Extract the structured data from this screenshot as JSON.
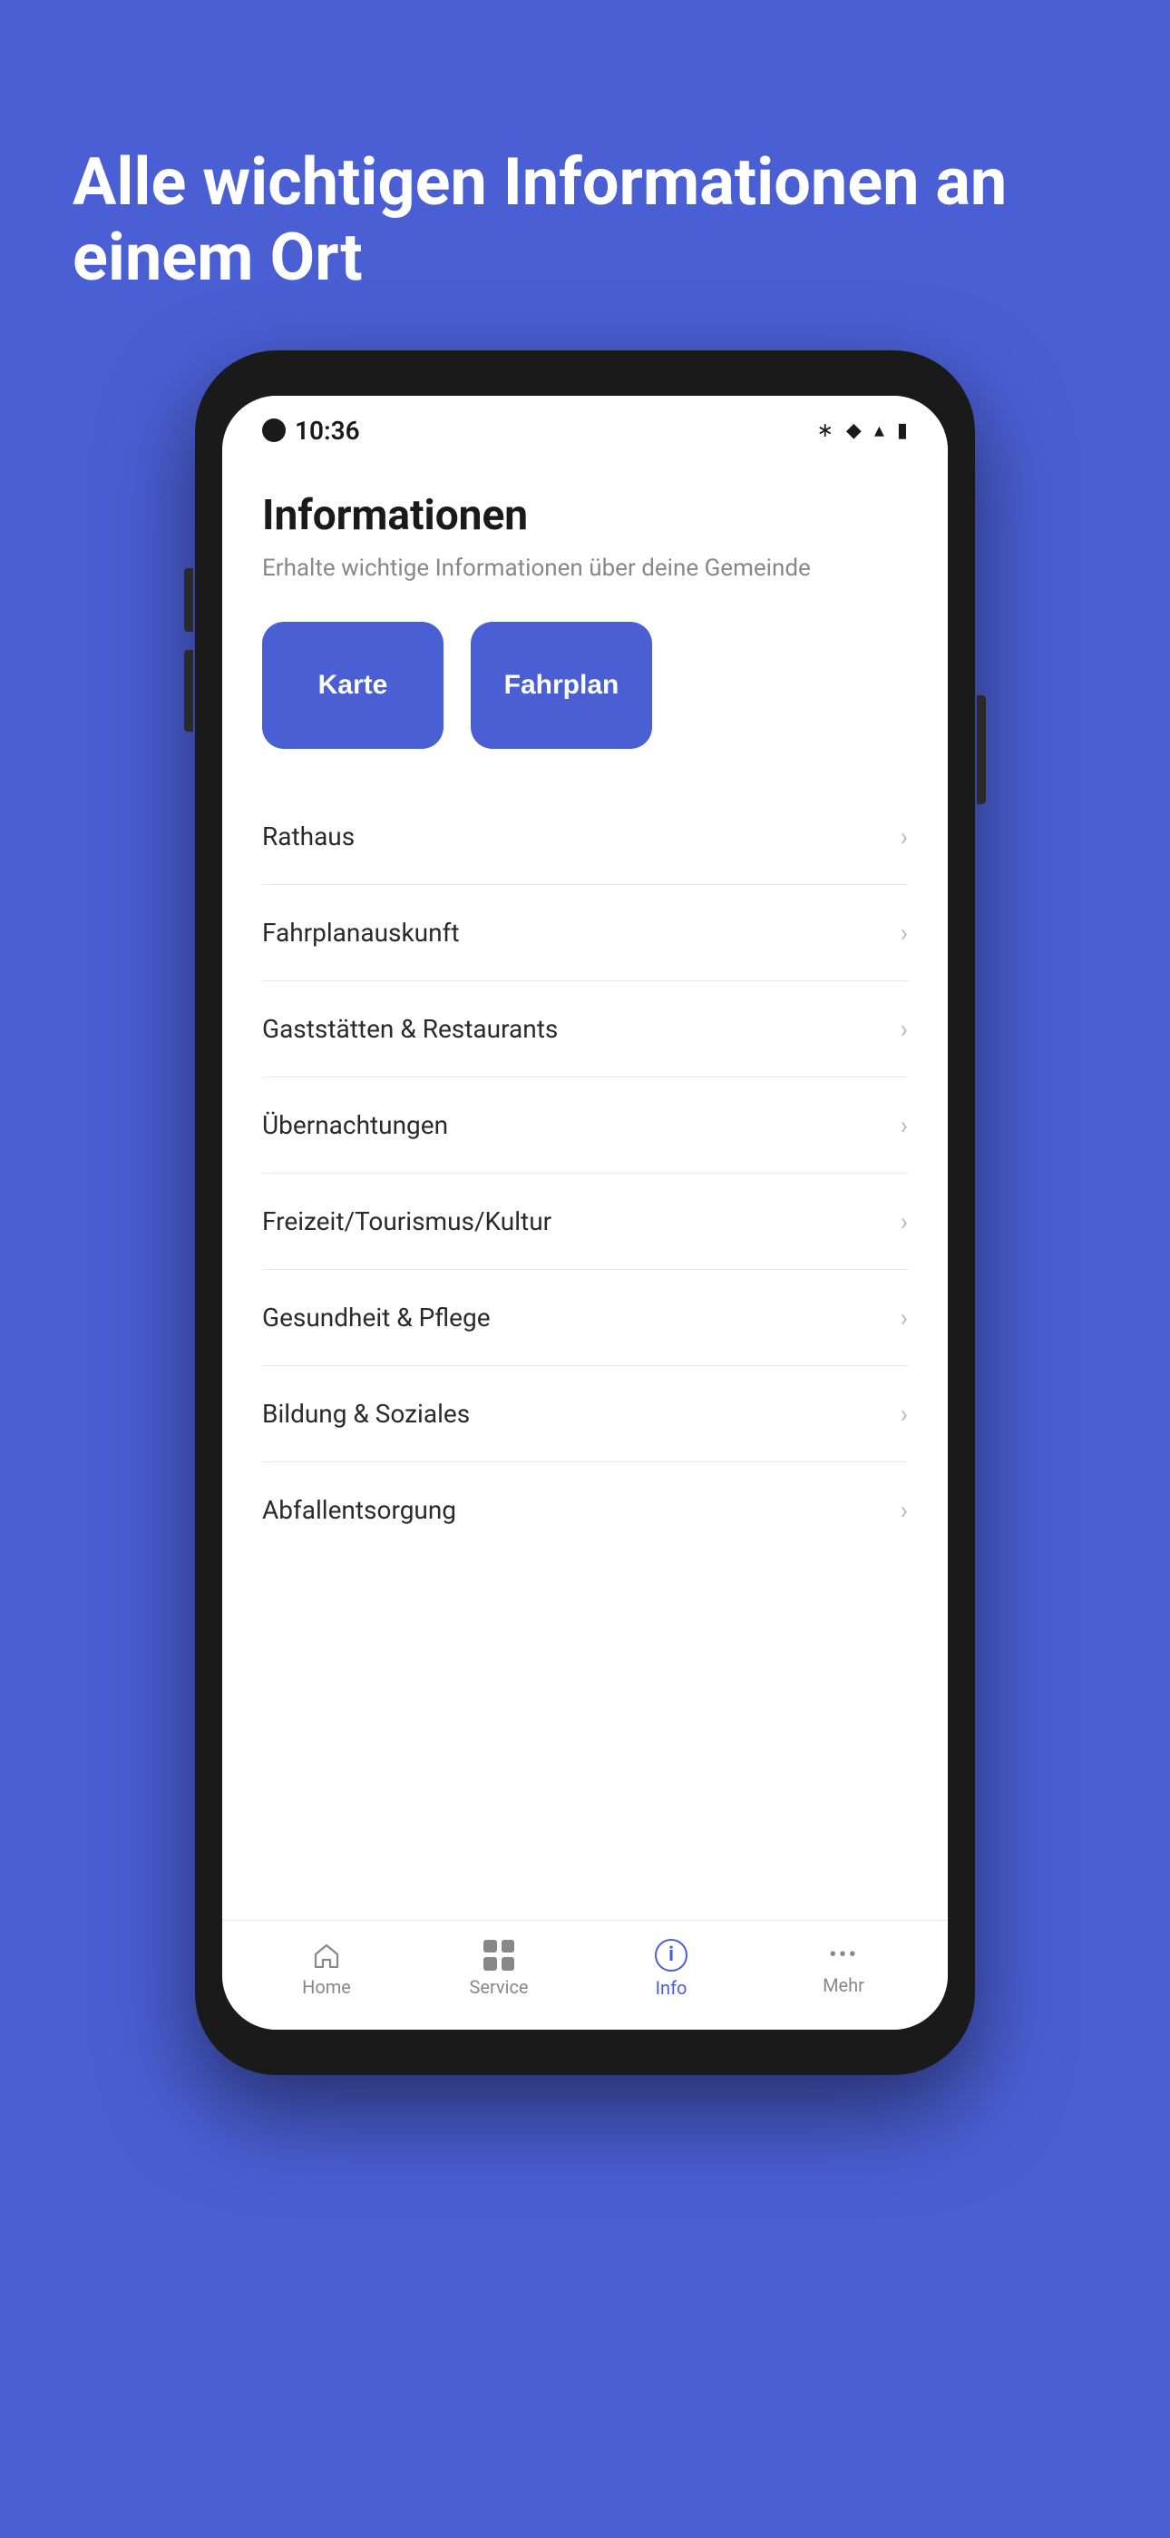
{
  "background_color": "#4a5fd4",
  "hero": {
    "title": "Alle wichtigen Informationen an einem Ort"
  },
  "phone": {
    "status_bar": {
      "time": "10:36",
      "icons": [
        "bluetooth",
        "bell-off",
        "wifi",
        "battery"
      ]
    },
    "app": {
      "title": "Informationen",
      "subtitle": "Erhalte wichtige Informationen über deine Gemeinde",
      "quick_buttons": [
        {
          "label": "Karte",
          "id": "karte"
        },
        {
          "label": "Fahrplan",
          "id": "fahrplan"
        }
      ],
      "menu_items": [
        {
          "label": "Rathaus",
          "id": "rathaus"
        },
        {
          "label": "Fahrplanauskunft",
          "id": "fahrplanauskunft"
        },
        {
          "label": "Gaststätten & Restaurants",
          "id": "gaststaetten"
        },
        {
          "label": "Übernachtungen",
          "id": "uebernachtungen"
        },
        {
          "label": "Freizeit/Tourismus/Kultur",
          "id": "freizeit"
        },
        {
          "label": "Gesundheit & Pflege",
          "id": "gesundheit"
        },
        {
          "label": "Bildung & Soziales",
          "id": "bildung"
        },
        {
          "label": "Abfallentsorgung",
          "id": "abfallentsorgung"
        }
      ]
    },
    "bottom_nav": [
      {
        "label": "Home",
        "icon": "home",
        "active": false
      },
      {
        "label": "Service",
        "icon": "grid",
        "active": false
      },
      {
        "label": "Info",
        "icon": "info-circle",
        "active": true
      },
      {
        "label": "Mehr",
        "icon": "dots",
        "active": false
      }
    ]
  }
}
